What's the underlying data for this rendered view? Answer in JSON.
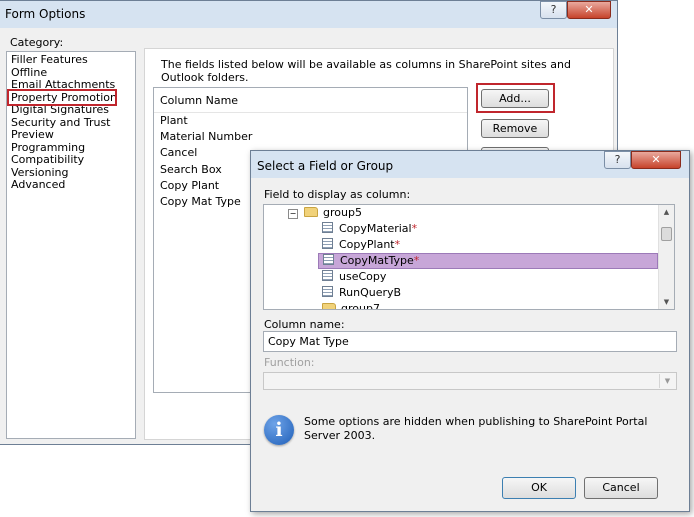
{
  "form_options": {
    "title": "Form Options",
    "help_btn": "?",
    "close_btn": "✕",
    "category_label": "Category:",
    "categories": [
      "Filler Features",
      "Offline",
      "Email Attachments",
      "Property Promotion",
      "Digital Signatures",
      "Security and Trust",
      "Preview",
      "Programming",
      "Compatibility",
      "Versioning",
      "Advanced"
    ],
    "description": "The fields listed below will be available as columns in SharePoint sites and Outlook folders.",
    "column_header": "Column Name",
    "fields": [
      "Plant",
      "Material Number",
      "Cancel",
      "Search Box",
      "Copy Plant",
      "Copy Mat Type"
    ],
    "add_button": "Add...",
    "remove_button": "Remove"
  },
  "select_field": {
    "title": "Select a Field or Group",
    "help_btn": "?",
    "close_btn": "✕",
    "field_label": "Field to display as column:",
    "tree": {
      "group5": "group5",
      "items": [
        {
          "label": "CopyMaterial",
          "required": "*"
        },
        {
          "label": "CopyPlant",
          "required": "*"
        },
        {
          "label": "CopyMatType",
          "required": "*"
        },
        {
          "label": "useCopy",
          "required": ""
        },
        {
          "label": "RunQueryB",
          "required": ""
        }
      ],
      "group7": "group7"
    },
    "column_name_label": "Column name:",
    "column_name_value": "Copy Mat Type",
    "function_label": "Function:",
    "info_text": "Some options are hidden when publishing to SharePoint Portal Server 2003.",
    "ok_button": "OK",
    "cancel_button": "Cancel"
  },
  "colors": {
    "selection_red": "#c0262d",
    "tree_selection": "#c7a6d8",
    "titlebar": "#d6e3f1",
    "info_icon": "#1f5fb8"
  }
}
